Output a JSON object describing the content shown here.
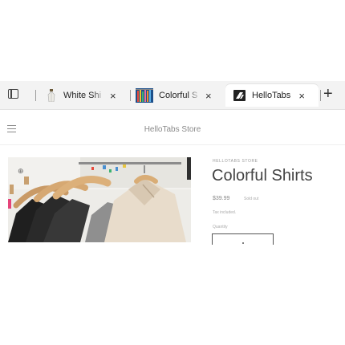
{
  "browser": {
    "tabs": [
      {
        "label": "White Shi",
        "close": "×",
        "active": false
      },
      {
        "label": "Colorful S",
        "close": "×",
        "active": false
      },
      {
        "label": "HelloTabs",
        "close": "×",
        "active": true
      }
    ],
    "new_tab": "+"
  },
  "header": {
    "store_name": "HelloTabs Store"
  },
  "product": {
    "vendor": "HELLOTABS STORE",
    "title": "Colorful Shirts",
    "price": "$39.99",
    "sold_out": "Sold out",
    "tax_note": "Tax included.",
    "quantity_label": "Quantity"
  },
  "colors": {
    "tab_bar": "#f3f3f3",
    "text_dark": "#444444",
    "text_muted": "#8a8a8a"
  }
}
